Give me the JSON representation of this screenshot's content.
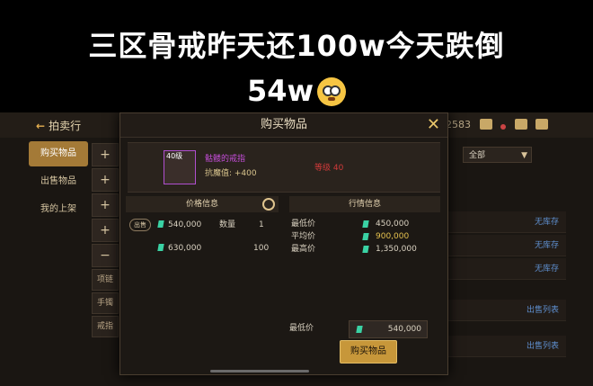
{
  "caption": {
    "line1": "三区骨戒昨天还100w今天跌倒",
    "line2": "54w"
  },
  "topbar": {
    "back_label": "拍卖行",
    "server_text": "2583"
  },
  "sidebar": {
    "items": [
      {
        "label": "购买物品"
      },
      {
        "label": "出售物品"
      },
      {
        "label": "我的上架"
      }
    ]
  },
  "subtabs": [
    "项链",
    "手镯",
    "戒指"
  ],
  "filter": {
    "selected": "全部"
  },
  "right_list": [
    "无库存",
    "无库存",
    "无库存",
    "出售列表",
    "出售列表"
  ],
  "modal": {
    "title": "购买物品",
    "item": {
      "level": "40级",
      "name": "骷髅的戒指",
      "stat": "抗魔值: +400",
      "requirement": "等级 40"
    },
    "price_header": "价格信息",
    "listings": [
      {
        "select": "出售",
        "price": "540,000",
        "qty_label": "数量",
        "qty": "1"
      },
      {
        "price": "630,000",
        "qty": "100"
      }
    ],
    "market": {
      "header": "行情信息",
      "rows": [
        {
          "label": "最低价",
          "value": "450,000"
        },
        {
          "label": "平均价",
          "value": "900,000"
        },
        {
          "label": "最高价",
          "value": "1,350,000"
        }
      ]
    },
    "min_price": {
      "label": "最低价",
      "value": "540,000"
    },
    "buy_button": "购买物品"
  }
}
